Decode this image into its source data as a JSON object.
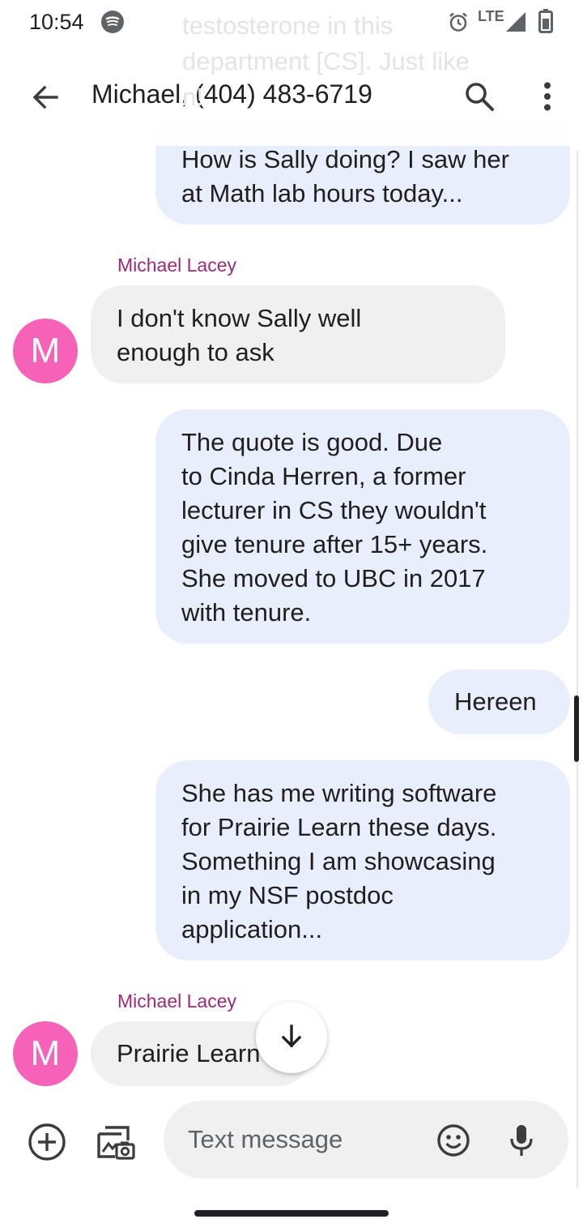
{
  "status_bar": {
    "time": "10:54",
    "network": "LTE",
    "icons": [
      "spotify-icon",
      "alarm-icon",
      "signal-icon",
      "battery-icon"
    ]
  },
  "header": {
    "title": "Michael, (404) 483-6719",
    "icons": [
      "back-arrow-icon",
      "search-icon",
      "more-vert-icon"
    ]
  },
  "notification_ghost": {
    "text": "testosterone in this\ndepartment [CS]. Just like\n                               n!"
  },
  "messages": [
    {
      "direction": "outgoing",
      "text": "How is Sally doing? I saw her\nat Math lab hours today..."
    },
    {
      "direction": "incoming",
      "sender": "Michael Lacey",
      "avatar": "M",
      "text": "I don't know Sally well\nenough to ask"
    },
    {
      "direction": "outgoing",
      "text": "The quote is good. Due\nto Cinda Herren, a former\nlecturer in CS they wouldn't\ngive tenure after 15+ years.\nShe moved to UBC in 2017\nwith tenure."
    },
    {
      "direction": "outgoing",
      "text": "Hereen"
    },
    {
      "direction": "outgoing",
      "text": "She has me writing software\nfor Prairie Learn these days.\nSomething I am showcasing\nin my NSF postdoc\napplication..."
    },
    {
      "direction": "incoming",
      "sender": "Michael Lacey",
      "avatar": "M",
      "text": "Prairie Learn"
    }
  ],
  "composer": {
    "placeholder": "Text message",
    "icons": [
      "add-circle-icon",
      "gallery-icon",
      "emoji-icon",
      "mic-icon"
    ]
  },
  "colors": {
    "outgoing_bubble": "#e8eefb",
    "incoming_bubble": "#f0f0f0",
    "avatar": "#f562b8",
    "sender_name": "#9c2b78"
  }
}
